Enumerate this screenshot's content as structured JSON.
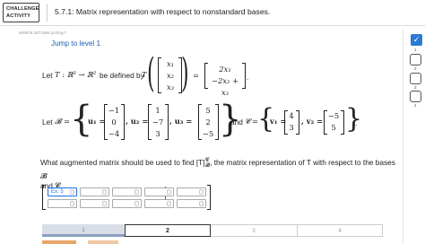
{
  "header": {
    "badge_line1": "CHALLENGE",
    "badge_line2": "ACTIVITY",
    "title": "5.7.1: Matrix representation with respect to nonstandard bases."
  },
  "task_id": "569876.3671898.qx3zqy7",
  "jump_link": "Jump to level 1",
  "definition": {
    "prefix": "Let",
    "map": "T : ℝ³ → ℝ²",
    "defined_by": "be defined by",
    "T": "T",
    "input_vector": [
      "x₁",
      "x₂",
      "x₃"
    ],
    "output_vector": [
      "2x₁",
      "−2x₂ + x₃"
    ],
    "period": "."
  },
  "bases": {
    "let": "Let",
    "B_symbol": "𝓑",
    "equals": "=",
    "u1_label": "u₁ =",
    "u1": [
      "−1",
      "0",
      "−4"
    ],
    "u2_label": ", u₂ =",
    "u2": [
      "1",
      "−7",
      "3"
    ],
    "u3_label": ", u₃ =",
    "u3": [
      "5",
      "2",
      "−5"
    ],
    "and": "and",
    "C_symbol": "𝓒",
    "v1_label": "v₁ =",
    "v1": [
      "4",
      "3"
    ],
    "v2_label": ", v₂ =",
    "v2": [
      "−5",
      "5"
    ],
    "period": "."
  },
  "question": {
    "line1": "What augmented matrix should be used to find [T]",
    "sup": "𝓒",
    "sub": "𝓑",
    "line1b": ", the matrix representation of T with respect to the bases 𝓑",
    "line2": "and 𝓒."
  },
  "matrix_inputs": {
    "row1": [
      {
        "value": "Ex: 5",
        "active": true
      },
      {
        "value": "",
        "active": false
      },
      {
        "value": "",
        "active": false
      },
      {
        "value": "",
        "active": false
      },
      {
        "value": "",
        "active": false
      }
    ],
    "row2": [
      {
        "value": "",
        "active": false
      },
      {
        "value": "",
        "active": false
      },
      {
        "value": "",
        "active": false
      },
      {
        "value": "",
        "active": false
      },
      {
        "value": "",
        "active": false
      }
    ]
  },
  "progress": {
    "segments": [
      "1",
      "2",
      "3",
      "4"
    ],
    "current": "2"
  },
  "sidebar": {
    "levels": [
      "1",
      "2",
      "3",
      "4"
    ]
  },
  "colors": {
    "link": "#1a5fb4",
    "check": "#2a7bd4",
    "active_input": "#1a73e8",
    "orange": "#e8a66b"
  }
}
